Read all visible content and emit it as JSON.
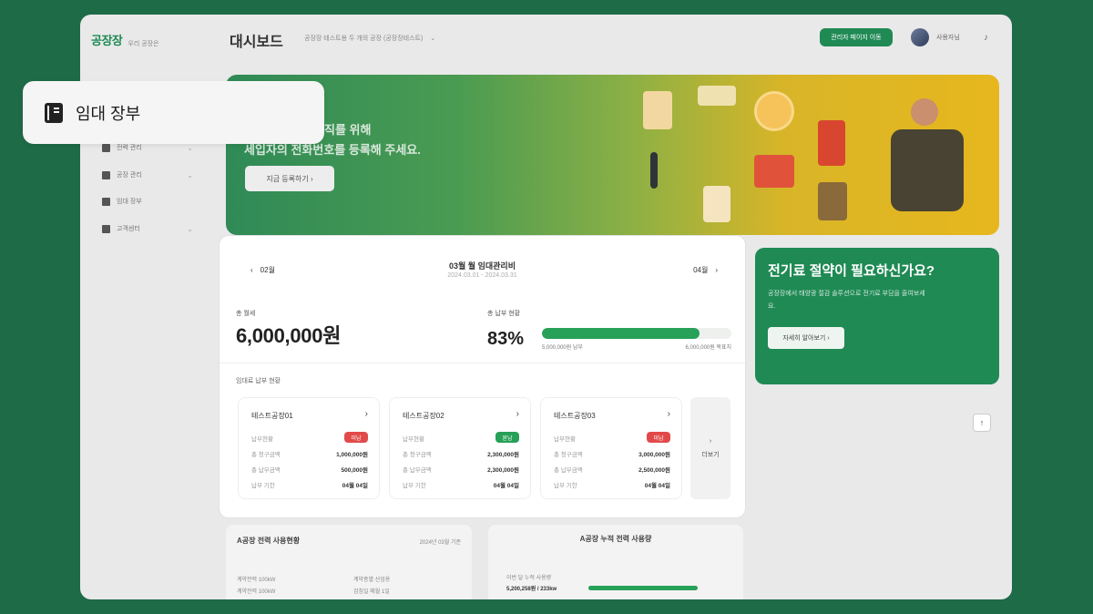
{
  "header": {
    "logo": "공장장",
    "logo_sub": "우리 공장은",
    "page_title": "대시보드",
    "factory_select": "공장장 테스트용 두 개의 공장 (공장장테스트)",
    "cta_button": "관리자 페이지 이동",
    "user_name": "사용자님"
  },
  "tooltip": {
    "label": "임대 장부"
  },
  "sidebar": {
    "items": [
      {
        "label": "전력 관리"
      },
      {
        "label": "공장 관리"
      },
      {
        "label": "임대 장부"
      },
      {
        "label": "고객센터"
      }
    ]
  },
  "banner": {
    "line1": "직를 위해",
    "line2": "세입자의 전화번호를 등록해 주세요.",
    "button": "지금 등록하기 ›"
  },
  "promo": {
    "title": "전기료 절약이 필요하신가요?",
    "desc": "공장장에서 태양광 절감 솔루션으로 전기료 부담을 줄여보세요.",
    "button": "자세히 알아보기 ›"
  },
  "rent": {
    "prev": "02월",
    "next": "04월",
    "title": "03월 월 임대관리비",
    "range": "2024.03.01 - 2024.03.31",
    "total_label": "총 월세",
    "total_amount": "6,000,000원",
    "rate_label": "총 납부 현황",
    "rate_value": "83%",
    "progress": 0.83,
    "paid_text": "5,000,000원 납부",
    "goal_text": "6,000,000원 목표치",
    "section_label": "임대료 납부 현황",
    "more_label": "더보기",
    "tenants": [
      {
        "name": "테스트공장01",
        "status": "미납",
        "status_color": "#e24a4a",
        "rows": [
          {
            "k": "납부현황",
            "v": ""
          },
          {
            "k": "총 청구금액",
            "v": "1,000,000원"
          },
          {
            "k": "총 납부금액",
            "v": "500,000원"
          },
          {
            "k": "납부 기한",
            "v": "04월 04일"
          }
        ]
      },
      {
        "name": "테스트공장02",
        "status": "완납",
        "status_color": "#27a058",
        "rows": [
          {
            "k": "납부현황",
            "v": ""
          },
          {
            "k": "총 청구금액",
            "v": "2,300,000원"
          },
          {
            "k": "총 납부금액",
            "v": "2,300,000원"
          },
          {
            "k": "납부 기한",
            "v": "04월 04일"
          }
        ]
      },
      {
        "name": "테스트공장03",
        "status": "미납",
        "status_color": "#e24a4a",
        "rows": [
          {
            "k": "납부현황",
            "v": ""
          },
          {
            "k": "총 청구금액",
            "v": "3,000,000원"
          },
          {
            "k": "총 납부금액",
            "v": "2,500,000원"
          },
          {
            "k": "납부 기한",
            "v": "04월 04일"
          }
        ]
      }
    ]
  },
  "bottom": {
    "left_title": "A공장 전력 사용현황",
    "left_meta": "2024년 03월 기준",
    "left_rows": [
      "계약전력 100kW",
      "계약종별 산업용",
      "계약전력 100kW",
      "검침일 매월 1일"
    ],
    "right_title": "A공장 누적 전력 사용량",
    "right_small": "이번 달 누적 사용량",
    "right_value": "5,200,258원 / 233kw"
  }
}
